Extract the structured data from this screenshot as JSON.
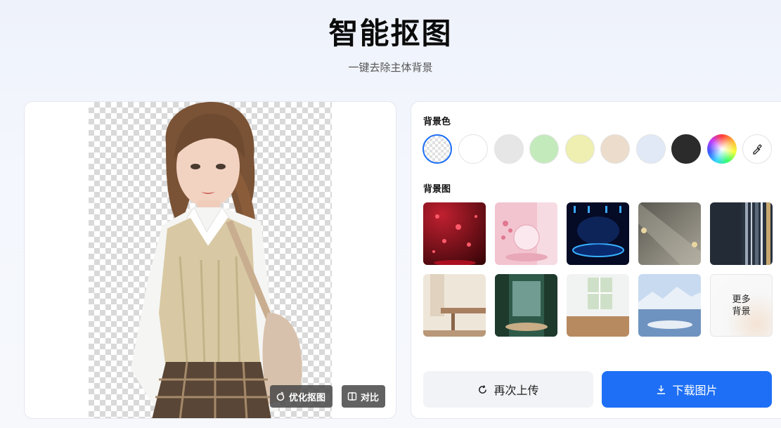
{
  "header": {
    "title": "智能抠图",
    "subtitle": "一键去除主体背景"
  },
  "preview": {
    "optimize_label": "优化抠图",
    "compare_label": "对比",
    "optimize_icon": "magic-wand-icon",
    "compare_icon": "compare-split-icon"
  },
  "panel": {
    "bg_color_label": "背景色",
    "bg_image_label": "背景图",
    "colors": [
      {
        "name": "transparent",
        "hex": "transparent"
      },
      {
        "name": "white",
        "hex": "#ffffff"
      },
      {
        "name": "light-gray",
        "hex": "#e6e6e6"
      },
      {
        "name": "light-green",
        "hex": "#c3eabb"
      },
      {
        "name": "light-yellow",
        "hex": "#efefb1"
      },
      {
        "name": "beige",
        "hex": "#ecdccb"
      },
      {
        "name": "light-blue",
        "hex": "#e1e9f7"
      },
      {
        "name": "dark",
        "hex": "#2b2b2b"
      },
      {
        "name": "rainbow-picker",
        "hex": "conic"
      },
      {
        "name": "eyedropper",
        "hex": "#ffffff"
      }
    ],
    "more_backgrounds_label": "更多\n背景",
    "reupload_label": "再次上传",
    "download_label": "下载图片"
  },
  "colors": {
    "accent": "#1e6ff5",
    "selected_ring": "#1e6ff5"
  }
}
